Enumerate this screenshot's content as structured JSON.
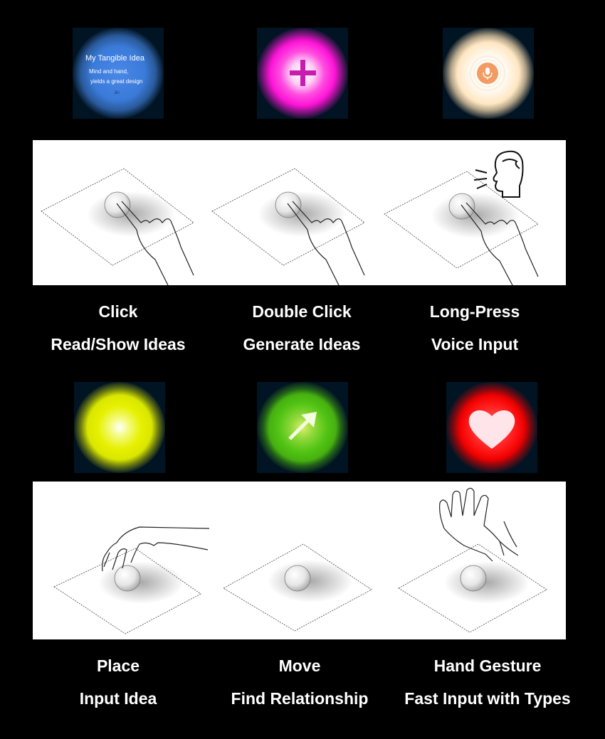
{
  "idea_tile": {
    "title": "My Tangible Idea",
    "line1": "Mind and hand,",
    "line2": "yields a great design",
    "author": "Jin"
  },
  "interactions": [
    {
      "action": "Click",
      "function": "Read/Show Ideas"
    },
    {
      "action": "Double Click",
      "function": "Generate Ideas"
    },
    {
      "action": "Long-Press",
      "function": "Voice Input"
    },
    {
      "action": "Place",
      "function": "Input Idea"
    },
    {
      "action": "Move",
      "function": "Find Relationship"
    },
    {
      "action": "Hand Gesture",
      "function": "Fast Input with Types"
    }
  ],
  "tiles": [
    {
      "state": "read-ideas",
      "color": "#3c7fe0",
      "icon": "text-card"
    },
    {
      "state": "generate-ideas",
      "color": "#ff18d8",
      "icon": "plus-icon"
    },
    {
      "state": "voice-input",
      "color": "#ffe9c9",
      "icon": "microphone-icon"
    },
    {
      "state": "input-idea",
      "color": "#e8f000",
      "icon": "none"
    },
    {
      "state": "find-relationship",
      "color": "#4fc515",
      "icon": "arrow-icon"
    },
    {
      "state": "fast-input-types",
      "color": "#ff0f0f",
      "icon": "heart-icon"
    }
  ]
}
